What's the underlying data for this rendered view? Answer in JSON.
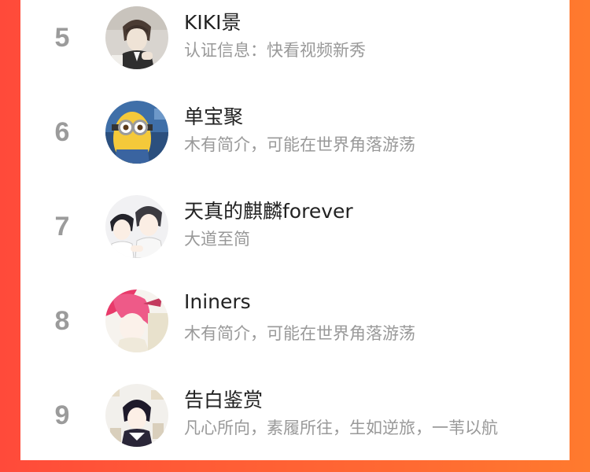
{
  "ranking": {
    "rows": [
      {
        "rank": "5",
        "name": "KIKI景",
        "desc": "认证信息：快看视频新秀",
        "avatar_icon": "avatar-boy-sketch-icon"
      },
      {
        "rank": "6",
        "name": "单宝聚",
        "desc": "木有简介，可能在世界角落游荡",
        "avatar_icon": "avatar-minion-icon"
      },
      {
        "rank": "7",
        "name": "天真的麒麟forever",
        "desc": "大道至简",
        "avatar_icon": "avatar-two-boys-icon"
      },
      {
        "rank": "8",
        "name": "Ininers",
        "desc": "木有简介，可能在世界角落游荡",
        "avatar_icon": "avatar-pink-hair-icon"
      },
      {
        "rank": "9",
        "name": "告白鉴赏",
        "desc": "凡心所向，素履所往，生如逆旅，一苇以航",
        "avatar_icon": "avatar-dark-hair-boy-icon"
      }
    ]
  },
  "colors": {
    "background_left": "#ff4a3a",
    "background_right": "#ff7a2e",
    "rank_gray": "#9b9b9b",
    "name_text": "#222222",
    "desc_text": "#999999"
  }
}
